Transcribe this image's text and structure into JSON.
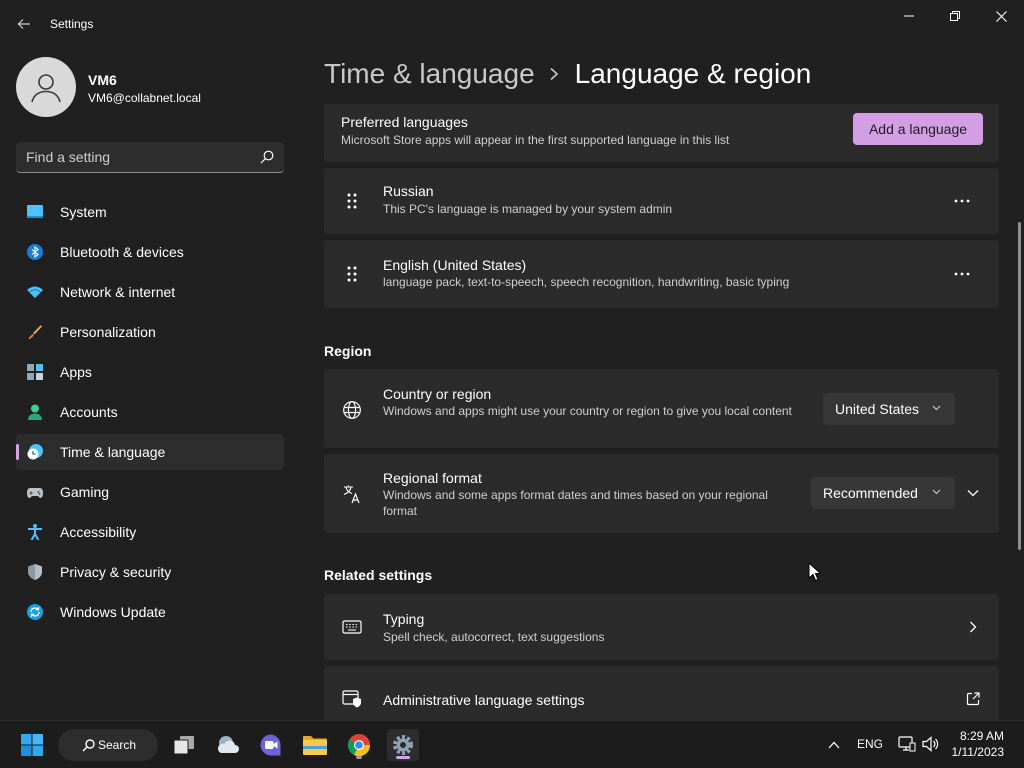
{
  "window": {
    "title": "Settings"
  },
  "user": {
    "name": "VM6",
    "email": "VM6@collabnet.local"
  },
  "search": {
    "placeholder": "Find a setting"
  },
  "sidebar": {
    "items": [
      {
        "label": "System",
        "icon": "system-icon"
      },
      {
        "label": "Bluetooth & devices",
        "icon": "bluetooth-icon"
      },
      {
        "label": "Network & internet",
        "icon": "network-icon"
      },
      {
        "label": "Personalization",
        "icon": "brush-icon"
      },
      {
        "label": "Apps",
        "icon": "apps-icon"
      },
      {
        "label": "Accounts",
        "icon": "accounts-icon"
      },
      {
        "label": "Time & language",
        "icon": "time-language-icon",
        "selected": true
      },
      {
        "label": "Gaming",
        "icon": "gaming-icon"
      },
      {
        "label": "Accessibility",
        "icon": "accessibility-icon"
      },
      {
        "label": "Privacy & security",
        "icon": "shield-icon"
      },
      {
        "label": "Windows Update",
        "icon": "windows-update-icon"
      }
    ]
  },
  "breadcrumb": {
    "parent": "Time & language",
    "current": "Language & region"
  },
  "preferred_languages": {
    "title": "Preferred languages",
    "subtitle": "Microsoft Store apps will appear in the first supported language in this list",
    "add_button": "Add a language",
    "languages": [
      {
        "name": "Russian",
        "detail": "This PC's language is managed by your system admin"
      },
      {
        "name": "English (United States)",
        "detail": "language pack, text-to-speech, speech recognition, handwriting, basic typing"
      }
    ]
  },
  "region": {
    "heading": "Region",
    "country": {
      "title": "Country or region",
      "subtitle": "Windows and apps might use your country or region to give you local content",
      "value": "United States"
    },
    "format": {
      "title": "Regional format",
      "subtitle": "Windows and some apps format dates and times based on your regional format",
      "value": "Recommended"
    }
  },
  "related": {
    "heading": "Related settings",
    "typing": {
      "title": "Typing",
      "subtitle": "Spell check, autocorrect, text suggestions"
    },
    "admin": {
      "title": "Administrative language settings"
    }
  },
  "taskbar": {
    "search_label": "Search",
    "language": "ENG",
    "time": "8:29 AM",
    "date": "1/11/2023"
  },
  "colors": {
    "accent": "#d49ee4",
    "background": "#202020",
    "card": "#2b2b2b",
    "taskbar": "#1c1c1c"
  }
}
